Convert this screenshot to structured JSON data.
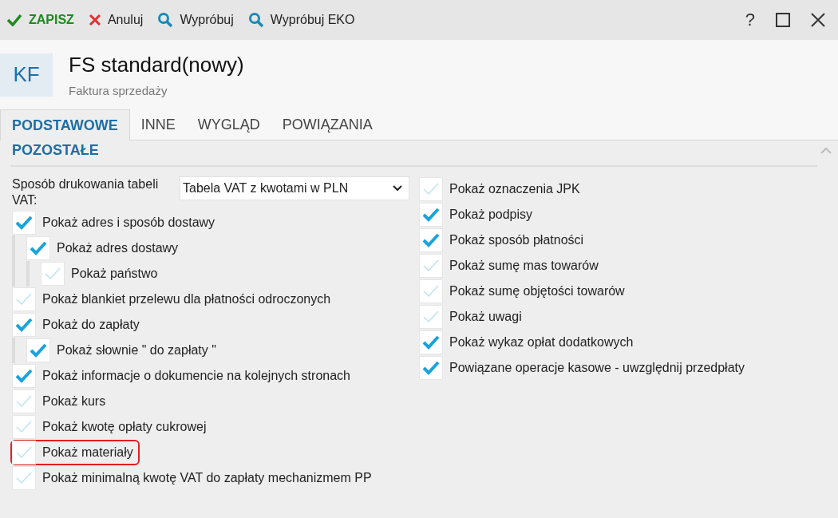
{
  "toolbar": [
    {
      "kind": "save",
      "label": "ZAPISZ"
    },
    {
      "kind": "cancel",
      "label": "Anuluj"
    },
    {
      "kind": "search",
      "label": "Wypróbuj"
    },
    {
      "kind": "search",
      "label": "Wypróbuj EKO"
    }
  ],
  "window_controls": [
    "?"
  ],
  "header": {
    "badge": "KF",
    "title": "FS standard(nowy)",
    "subtitle": "Faktura sprzedaży"
  },
  "tabs": [
    {
      "label": "PODSTAWOWE",
      "selected": true
    },
    {
      "label": "INNE",
      "selected": false
    },
    {
      "label": "WYGLĄD",
      "selected": false
    },
    {
      "label": "POWIĄZANIA",
      "selected": false
    }
  ],
  "section": {
    "title": "POZOSTAŁE",
    "expanded": true
  },
  "vat_table": {
    "label": "Sposób drukowania tabeli VAT:",
    "value": "Tabela VAT z kwotami w PLN"
  },
  "left_options": [
    {
      "label": "Pokaż adres i sposób dostawy",
      "checked": true,
      "highlighted": false,
      "children": [
        {
          "label": "Pokaż adres dostawy",
          "checked": true,
          "highlighted": false,
          "children": [
            {
              "label": "Pokaż państwo",
              "checked": false,
              "highlighted": false
            }
          ]
        }
      ]
    },
    {
      "label": "Pokaż blankiet przelewu dla płatności odroczonych",
      "checked": false,
      "highlighted": false
    },
    {
      "label": "Pokaż do zapłaty",
      "checked": true,
      "highlighted": false,
      "children": [
        {
          "label": "Pokaż słownie \" do zapłaty \"",
          "checked": true,
          "highlighted": false
        }
      ]
    },
    {
      "label": "Pokaż informacje o dokumencie na kolejnych stronach",
      "checked": true,
      "highlighted": false
    },
    {
      "label": "Pokaż kurs",
      "checked": false,
      "highlighted": false
    },
    {
      "label": "Pokaż kwotę opłaty cukrowej",
      "checked": false,
      "highlighted": false
    },
    {
      "label": "Pokaż materiały",
      "checked": false,
      "highlighted": true
    },
    {
      "label": "Pokaż minimalną kwotę VAT do zapłaty mechanizmem PP",
      "checked": false,
      "highlighted": false
    }
  ],
  "right_options": [
    {
      "label": "Pokaż oznaczenia JPK",
      "checked": false,
      "highlighted": false
    },
    {
      "label": "Pokaż podpisy",
      "checked": true,
      "highlighted": false
    },
    {
      "label": "Pokaż sposób płatności",
      "checked": true,
      "highlighted": false
    },
    {
      "label": "Pokaż sumę mas towarów",
      "checked": false,
      "highlighted": false
    },
    {
      "label": "Pokaż sumę objętości towarów",
      "checked": false,
      "highlighted": false
    },
    {
      "label": "Pokaż uwagi",
      "checked": false,
      "highlighted": false
    },
    {
      "label": "Pokaż wykaz opłat dodatkowych",
      "checked": true,
      "highlighted": false
    },
    {
      "label": "Powiązane operacje kasowe - uwzględnij przedpłaty",
      "checked": true,
      "highlighted": false
    }
  ]
}
